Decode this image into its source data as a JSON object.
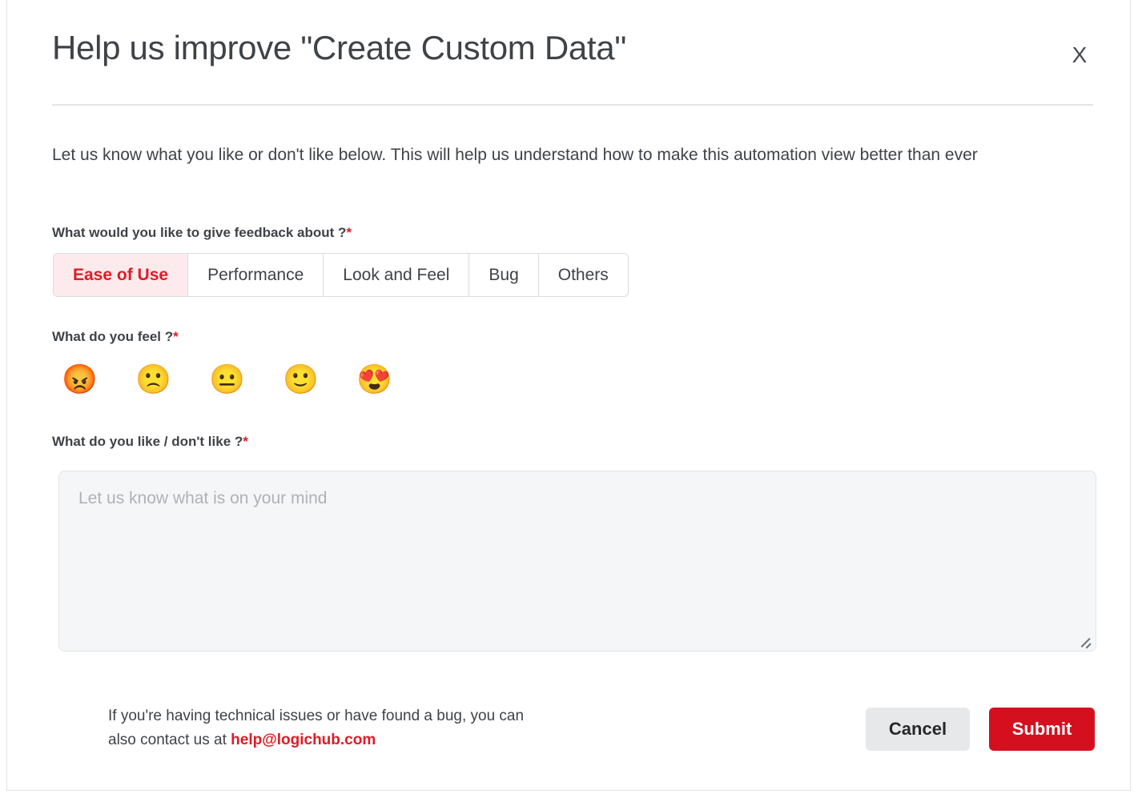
{
  "theme": {
    "accent_red": "#d4101f",
    "link_red": "#e01b24",
    "selected_tab_bg": "#fdeaec",
    "text_dark": "#3f4347",
    "cancel_bg": "#e7e8ea",
    "textarea_bg": "#f5f6f7"
  },
  "dialog": {
    "title": "Help us improve \"Create Custom Data\"",
    "close_label": "X",
    "intro": "Let us know what you like or don't like below. This will help us understand how to make this automation view better than ever"
  },
  "topic": {
    "label": "What would you like to give feedback about ?",
    "required_marker": "*",
    "selected": "Ease of Use",
    "options": [
      {
        "label": "Ease of Use",
        "selected": true
      },
      {
        "label": "Performance",
        "selected": false
      },
      {
        "label": "Look and Feel",
        "selected": false
      },
      {
        "label": "Bug",
        "selected": false
      },
      {
        "label": "Others",
        "selected": false
      }
    ]
  },
  "feeling": {
    "label": "What do you feel ?",
    "required_marker": "*",
    "options": [
      {
        "name": "angry-face-emoji",
        "glyph": "😡",
        "rating": 1
      },
      {
        "name": "frowning-face-emoji",
        "glyph": "🙁",
        "rating": 2
      },
      {
        "name": "neutral-face-emoji",
        "glyph": "😐",
        "rating": 3
      },
      {
        "name": "slightly-smiling-face-emoji",
        "glyph": "🙂",
        "rating": 4
      },
      {
        "name": "heart-eyes-face-emoji",
        "glyph": "😍",
        "rating": 5
      }
    ],
    "selected": null
  },
  "comment": {
    "label": "What do you like / don't like ?",
    "required_marker": "*",
    "placeholder": "Let us know what is on your mind",
    "value": ""
  },
  "footer": {
    "note_line1": "If you're having technical issues or have found a bug, you can",
    "note_line2_prefix": "also contact us at ",
    "support_email": "help@logichub.com",
    "cancel_label": "Cancel",
    "submit_label": "Submit"
  }
}
